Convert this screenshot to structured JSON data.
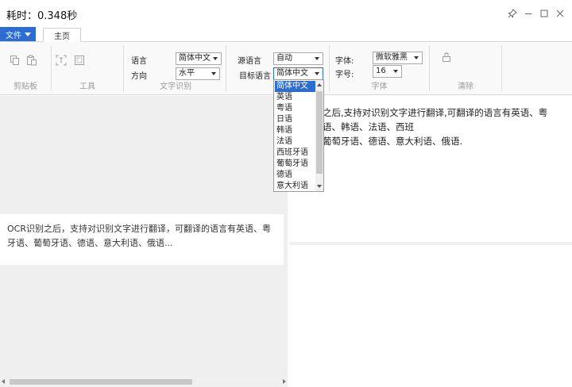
{
  "window": {
    "title": "耗时：0.348秒",
    "controls": [
      "pin-icon",
      "minimize-icon",
      "maximize-icon",
      "close-icon"
    ]
  },
  "menu": {
    "file_label": "文件",
    "tabs": [
      {
        "label": "主页",
        "active": true
      }
    ]
  },
  "ribbon": {
    "clipboard": {
      "label": "剪贴板",
      "icons": [
        "copy-icon",
        "paste-icon"
      ]
    },
    "tools": {
      "label": "工具",
      "icons": [
        "scan-frame-icon",
        "screenshot-icon"
      ]
    },
    "ocr": {
      "label": "文字识别",
      "language_label": "语言",
      "language_value": "简体中文",
      "direction_label": "方向",
      "direction_value": "水平"
    },
    "translate": {
      "source_label": "源语言",
      "source_value": "自动",
      "target_label": "目标语言",
      "target_value": "简体中文"
    },
    "font": {
      "label": "字体",
      "family_label": "字体:",
      "family_value": "微软雅黑",
      "size_label": "字号:",
      "size_value": "16"
    },
    "clear": {
      "label": "清除",
      "icon": "clear-icon"
    }
  },
  "target_dropdown": {
    "options": [
      "简体中文",
      "英语",
      "粤语",
      "日语",
      "韩语",
      "法语",
      "西班牙语",
      "葡萄牙语",
      "德语",
      "意大利语"
    ],
    "selected_index": 0
  },
  "source_text": {
    "lines": [
      "OCR识别之后，支持对识别文字进行翻译，可翻译的语言有英语、粤",
      "牙语、葡萄牙语、德语、意大利语、俄语..."
    ]
  },
  "translated_text": {
    "lines": [
      "之后,支持对识别文字进行翻译,可翻译的语言有英语、粤",
      "语、韩语、法语、西班",
      "葡萄牙语、德语、意大利语、俄语."
    ]
  },
  "colors": {
    "accent": "#2d6dd2",
    "ribbon_bg": "#f9f9f9",
    "pane_bg": "#efefef"
  }
}
